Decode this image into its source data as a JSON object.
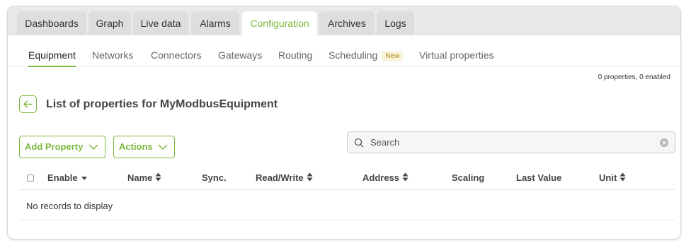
{
  "tabs": [
    {
      "label": "Dashboards"
    },
    {
      "label": "Graph"
    },
    {
      "label": "Live data"
    },
    {
      "label": "Alarms"
    },
    {
      "label": "Configuration",
      "active": true
    },
    {
      "label": "Archives"
    },
    {
      "label": "Logs"
    }
  ],
  "subnav": {
    "items": [
      {
        "label": "Equipment",
        "active": true
      },
      {
        "label": "Networks"
      },
      {
        "label": "Connectors"
      },
      {
        "label": "Gateways"
      },
      {
        "label": "Routing"
      },
      {
        "label": "Scheduling",
        "badge": "New"
      },
      {
        "label": "Virtual properties"
      }
    ]
  },
  "summary": "0 properties, 0 enabled",
  "page": {
    "title": "List of properties for MyModbusEquipment"
  },
  "toolbar": {
    "add_label": "Add Property",
    "actions_label": "Actions"
  },
  "search": {
    "placeholder": "Search",
    "value": ""
  },
  "table": {
    "columns": [
      {
        "label": "Enable",
        "sort": "desc"
      },
      {
        "label": "Name",
        "sort": "both"
      },
      {
        "label": "Sync.",
        "sort": "none"
      },
      {
        "label": "Read/Write",
        "sort": "both"
      },
      {
        "label": "Address",
        "sort": "both"
      },
      {
        "label": "Scaling",
        "sort": "none"
      },
      {
        "label": "Last Value",
        "sort": "none"
      },
      {
        "label": "Unit",
        "sort": "both"
      }
    ],
    "empty_text": "No records to display"
  },
  "colors": {
    "accent": "#7cb83d",
    "badge_text": "#b58a1a",
    "badge_bg": "#fbf4dc"
  }
}
